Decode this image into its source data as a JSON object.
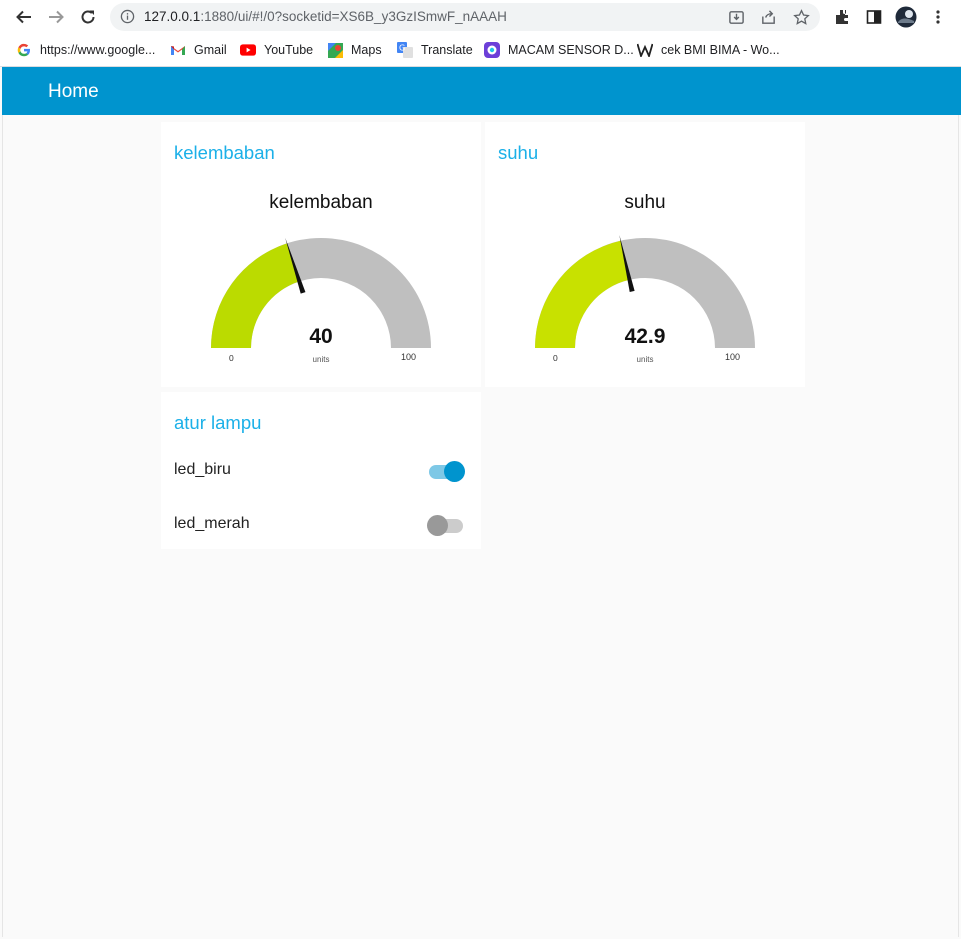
{
  "browser": {
    "url_host": "127.0.0.1",
    "url_rest": ":1880/ui/#!/0?socketid=XS6B_y3GzISmwF_nAAAH",
    "bookmarks": [
      {
        "label": "https://www.google...",
        "icon": "google-icon"
      },
      {
        "label": "Gmail",
        "icon": "gmail-icon"
      },
      {
        "label": "YouTube",
        "icon": "youtube-icon"
      },
      {
        "label": "Maps",
        "icon": "maps-icon"
      },
      {
        "label": "Translate",
        "icon": "translate-icon"
      },
      {
        "label": "MACAM SENSOR D...",
        "icon": "bookmark-app-icon"
      },
      {
        "label": "cek BMI BIMA - Wo...",
        "icon": "wordpress-icon"
      }
    ]
  },
  "app": {
    "title": "Home"
  },
  "gauges": [
    {
      "group": "kelembaban",
      "title": "kelembaban",
      "value": "40",
      "value_num": 40,
      "units": "units",
      "min": "0",
      "max": "100",
      "color": "#bbdb00"
    },
    {
      "group": "suhu",
      "title": "suhu",
      "value": "42.9",
      "value_num": 42.9,
      "units": "units",
      "min": "0",
      "max": "100",
      "color": "#c8e100"
    }
  ],
  "lamp": {
    "group": "atur lampu",
    "switches": [
      {
        "label": "led_biru",
        "on": true
      },
      {
        "label": "led_merah",
        "on": false
      }
    ]
  },
  "colors": {
    "header": "#0094ce",
    "group_title": "#1bb0e8",
    "gauge_bg": "#bfbfbf",
    "switch_on_knob": "#0094ce",
    "switch_on_track": "#7ec8e6",
    "switch_off_knob": "#999999",
    "switch_off_track": "#cccccc"
  }
}
